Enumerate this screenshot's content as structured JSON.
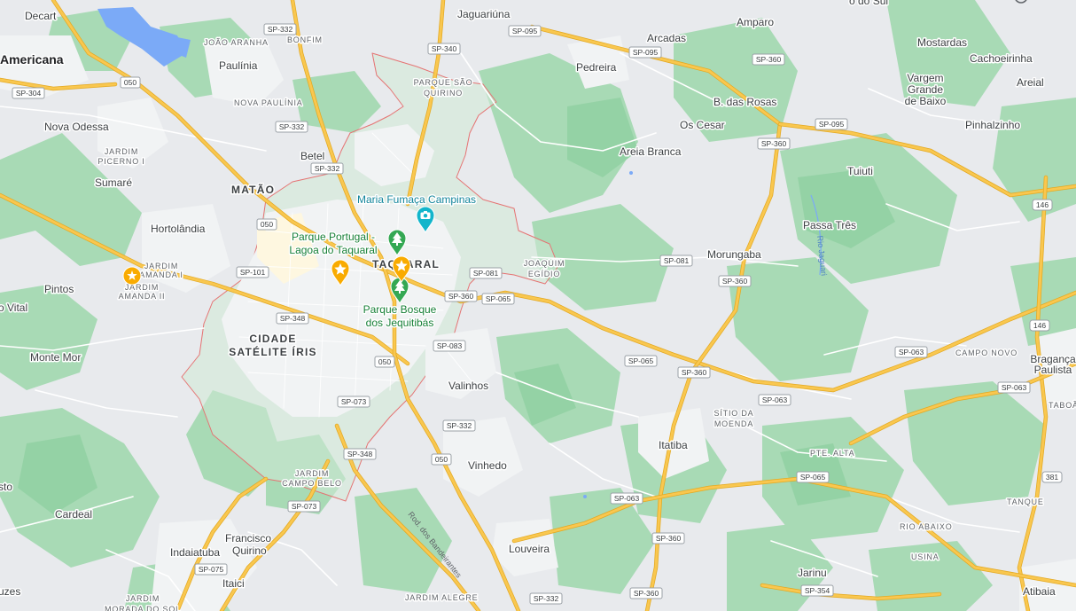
{
  "map": {
    "colors": {
      "land": "#e8eaed",
      "green": "#a8dab5",
      "green_dark": "#94d2a5",
      "urban": "#f1f3f4",
      "water": "#7baaf7",
      "highway": "#f9c74f",
      "boundary": "#e57373",
      "pin_yellow": "#f9ab00",
      "pin_green": "#34a853",
      "pin_teal": "#12b5cb"
    },
    "cities": [
      {
        "key": "americana",
        "label": "Americana",
        "size": "big"
      },
      {
        "key": "decart",
        "label": "Decart"
      },
      {
        "key": "paulinia",
        "label": "Paulínia"
      },
      {
        "key": "nova_odessa",
        "label": "Nova Odessa"
      },
      {
        "key": "sumare",
        "label": "Sumaré"
      },
      {
        "key": "hortolandia",
        "label": "Hortolândia"
      },
      {
        "key": "pintos",
        "label": "Pintos"
      },
      {
        "key": "vital",
        "label": "o Vital"
      },
      {
        "key": "monte_mor",
        "label": "Monte Mor"
      },
      {
        "key": "sto",
        "label": "sto"
      },
      {
        "key": "cardeal",
        "label": "Cardeal"
      },
      {
        "key": "indaiatuba",
        "label": "Indaiatuba"
      },
      {
        "key": "uzes",
        "label": "uzes"
      },
      {
        "key": "francisco_quirino",
        "label": "Francisco\nQuirino"
      },
      {
        "key": "itaici",
        "label": "Itaici"
      },
      {
        "key": "betel",
        "label": "Betel"
      },
      {
        "key": "jaguariuna",
        "label": "Jaguariúna"
      },
      {
        "key": "pedreira",
        "label": "Pedreira"
      },
      {
        "key": "arcadas",
        "label": "Arcadas"
      },
      {
        "key": "amparo",
        "label": "Amparo"
      },
      {
        "key": "do_sul",
        "label": "o do Sul"
      },
      {
        "key": "mostardas",
        "label": "Mostardas"
      },
      {
        "key": "cachoeirinha",
        "label": "Cachoeirinha"
      },
      {
        "key": "vargem",
        "label": "Vargem\nGrande\nde Baixo"
      },
      {
        "key": "areial",
        "label": "Areial"
      },
      {
        "key": "b_das_rosas",
        "label": "B. das Rosas"
      },
      {
        "key": "os_cesar",
        "label": "Os Cesar"
      },
      {
        "key": "pinhalzinho",
        "label": "Pinhalzinho"
      },
      {
        "key": "areia_branca",
        "label": "Areia Branca"
      },
      {
        "key": "tuiuti",
        "label": "Tuiuti"
      },
      {
        "key": "passa_tres",
        "label": "Passa Três"
      },
      {
        "key": "morungaba",
        "label": "Morungaba"
      },
      {
        "key": "valinhos",
        "label": "Valinhos"
      },
      {
        "key": "vinhedo",
        "label": "Vinhedo"
      },
      {
        "key": "itatiba",
        "label": "Itatiba"
      },
      {
        "key": "louveira",
        "label": "Louveira"
      },
      {
        "key": "jarinu",
        "label": "Jarinu"
      },
      {
        "key": "atibaia",
        "label": "Atibaia"
      },
      {
        "key": "braganca",
        "label": "Bragança\nPaulista"
      },
      {
        "key": "taboa",
        "label": "TABOÃ"
      }
    ],
    "neighborhoods": [
      {
        "key": "joao_aranha",
        "label": "JOÃO ARANHA"
      },
      {
        "key": "bonfim",
        "label": "BONFIM"
      },
      {
        "key": "nova_paulinia",
        "label": "NOVA PAULÍNIA"
      },
      {
        "key": "jardim_picerno",
        "label": "JARDIM\nPICERNO I"
      },
      {
        "key": "matao",
        "label": "MATÃO"
      },
      {
        "key": "jardim_amanda_1",
        "label": "JARDIM\nAMANDA I"
      },
      {
        "key": "jardim_amanda_2",
        "label": "JARDIM\nAMANDA II"
      },
      {
        "key": "parque_sao_quirino",
        "label": "PARQUE SÃO\nQUIRINO"
      },
      {
        "key": "joaquim_egidio",
        "label": "JOAQUIM\nEGÍDIO"
      },
      {
        "key": "taquaral",
        "label": "TAQUARAL"
      },
      {
        "key": "cidade_satelite",
        "label": "CIDADE\nSATÉLITE ÍRIS",
        "size": "big"
      },
      {
        "key": "jardim_campo_belo",
        "label": "JARDIM\nCAMPO BELO"
      },
      {
        "key": "jardim_morada",
        "label": "JARDIM\nMORADA DO SOL"
      },
      {
        "key": "sitio_moenda",
        "label": "SÍTIO DA\nMOENDA"
      },
      {
        "key": "pte_alta",
        "label": "PTE. ALTA"
      },
      {
        "key": "campo_novo",
        "label": "CAMPO NOVO"
      },
      {
        "key": "rio_abaixo",
        "label": "RIO ABAIXO"
      },
      {
        "key": "tanque",
        "label": "TANQUE"
      },
      {
        "key": "usina",
        "label": "USINA"
      },
      {
        "key": "jardim_alegre",
        "label": "JARDIM ALEGRE"
      }
    ],
    "pois": [
      {
        "key": "maria_fumaca",
        "label": "Maria Fumaça Campinas",
        "kind": "camera"
      },
      {
        "key": "parque_portugal",
        "label": "Parque Portugal -\nLagoa do Taquaral",
        "kind": "park"
      },
      {
        "key": "parque_bosque",
        "label": "Parque Bosque\ndos Jequitibás",
        "kind": "park"
      }
    ],
    "saved_places": [
      "star-pin-1",
      "star-pin-2",
      "star-pin-3"
    ],
    "river_label": "Rio Jaguari",
    "road_name": "Rod. dos Bandeirantes",
    "shields": [
      "SP-332",
      "SP-332",
      "SP-332",
      "SP-332",
      "SP-340",
      "SP-095",
      "SP-095",
      "SP-095",
      "SP-360",
      "SP-360",
      "SP-360",
      "SP-360",
      "SP-360",
      "SP-360",
      "SP-360",
      "SP-304",
      "050",
      "050",
      "050",
      "050",
      "SP-101",
      "SP-348",
      "SP-348",
      "SP-081",
      "SP-081",
      "SP-065",
      "SP-065",
      "SP-065",
      "SP-083",
      "SP-073",
      "SP-073",
      "SP-063",
      "SP-063",
      "SP-063",
      "SP-063",
      "SP-075",
      "SP-354",
      "SP-332",
      "146",
      "146",
      "381"
    ]
  }
}
